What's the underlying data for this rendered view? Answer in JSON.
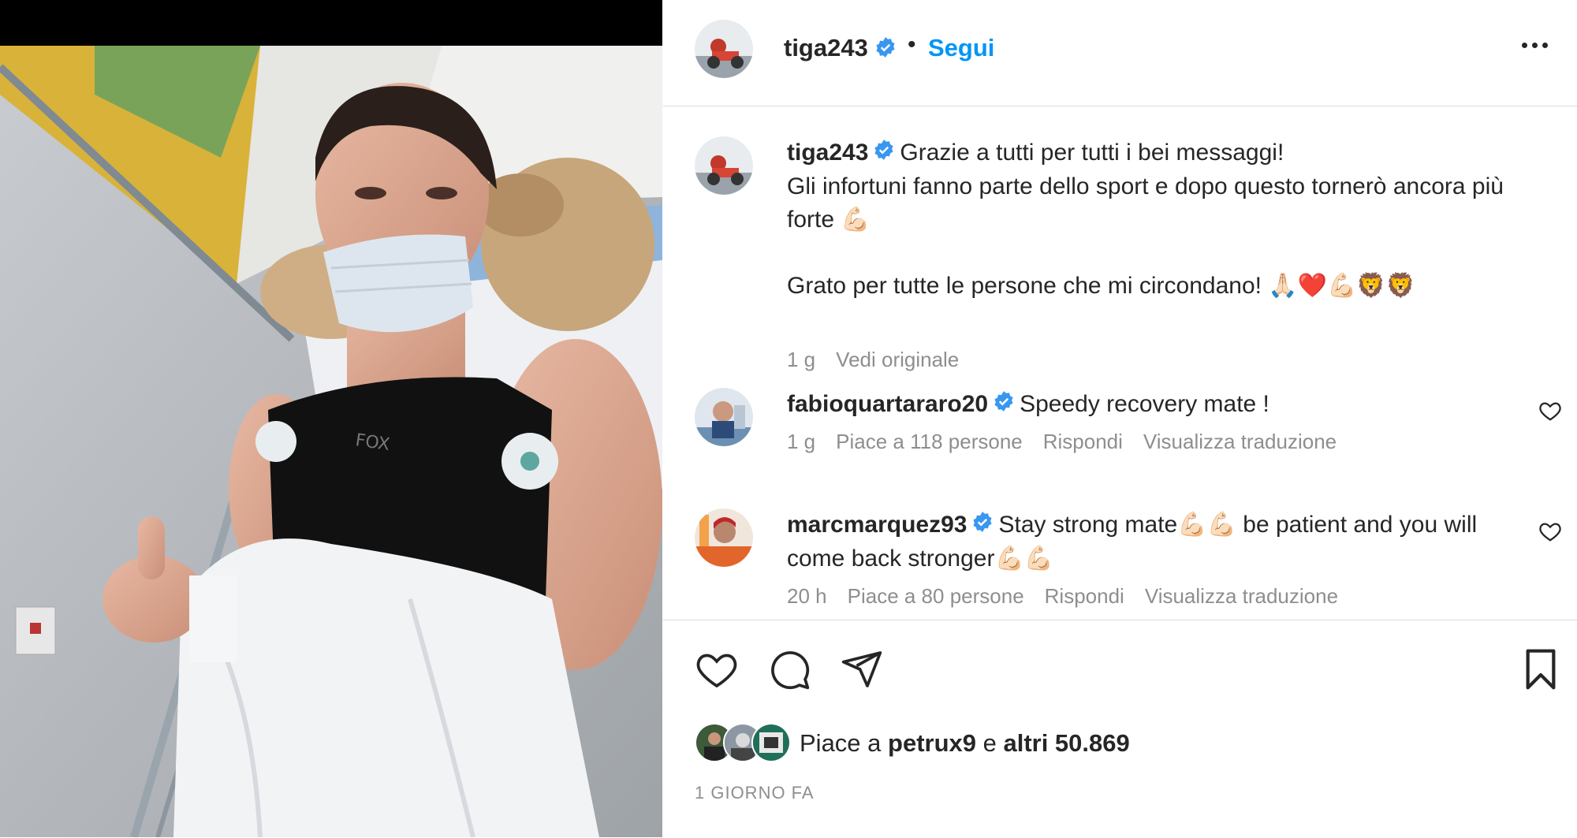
{
  "header": {
    "username": "tiga243",
    "separator": "•",
    "follow_label": "Segui",
    "more_icon": "more-horizontal-icon"
  },
  "caption": {
    "username": "tiga243",
    "line1": "Grazie a tutti per tutti i bei messaggi!",
    "line2": "Gli infortuni fanno parte dello sport e dopo questo tornerò ancora più forte 💪🏻",
    "line3": "Grato per tutte le persone che mi circondano! 🙏🏻❤️💪🏻🦁🦁",
    "time": "1 g",
    "see_original": "Vedi originale"
  },
  "comments": [
    {
      "username": "fabioquartararo20",
      "text": "Speedy recovery mate !",
      "time": "1 g",
      "likes": "Piace a 118 persone",
      "reply": "Rispondi",
      "translate": "Visualizza traduzione"
    },
    {
      "username": "marcmarquez93",
      "text": "Stay strong mate💪🏻💪🏻 be patient and you will come back stronger💪🏻💪🏻",
      "time": "20 h",
      "likes": "Piace a 80 persone",
      "reply": "Rispondi",
      "translate": "Visualizza traduzione"
    }
  ],
  "likes": {
    "prefix": "Piace a ",
    "user": "petrux9",
    "middle": " e ",
    "others": "altri 50.869"
  },
  "date": "1 GIORNO FA",
  "colors": {
    "accent": "#0095f6",
    "verified": "#3897f0",
    "muted": "#8e8e8e",
    "text": "#262626"
  }
}
